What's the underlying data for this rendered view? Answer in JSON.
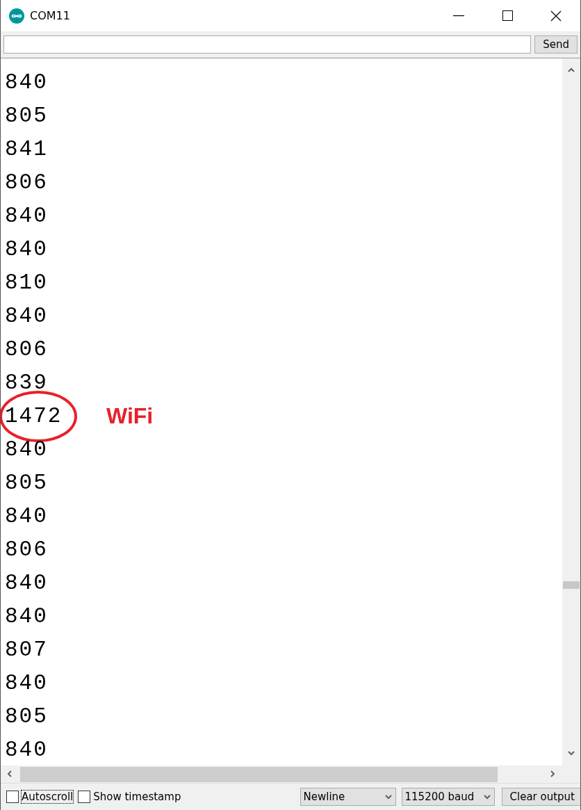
{
  "window": {
    "title": "COM11"
  },
  "input": {
    "send_button": "Send"
  },
  "lines": [
    {
      "text": "840",
      "circled": false
    },
    {
      "text": "805",
      "circled": false
    },
    {
      "text": "841",
      "circled": false
    },
    {
      "text": "806",
      "circled": false
    },
    {
      "text": "840",
      "circled": false
    },
    {
      "text": "840",
      "circled": false
    },
    {
      "text": "810",
      "circled": false
    },
    {
      "text": "840",
      "circled": false
    },
    {
      "text": "806",
      "circled": false
    },
    {
      "text": "839",
      "circled": false
    },
    {
      "text": "1472",
      "circled": true,
      "note": "WiFi"
    },
    {
      "text": "840",
      "circled": false
    },
    {
      "text": "805",
      "circled": false
    },
    {
      "text": "840",
      "circled": false
    },
    {
      "text": "806",
      "circled": false
    },
    {
      "text": "840",
      "circled": false
    },
    {
      "text": "840",
      "circled": false
    },
    {
      "text": "807",
      "circled": false
    },
    {
      "text": "840",
      "circled": false
    },
    {
      "text": "805",
      "circled": false
    },
    {
      "text": "840",
      "circled": false
    }
  ],
  "status_bar": {
    "autoscroll": {
      "label": "Autoscroll",
      "checked": false
    },
    "show_timestamp": {
      "label": "Show timestamp",
      "checked": false
    },
    "line_ending": "Newline",
    "baud_rate": "115200 baud",
    "clear_button": "Clear output"
  }
}
